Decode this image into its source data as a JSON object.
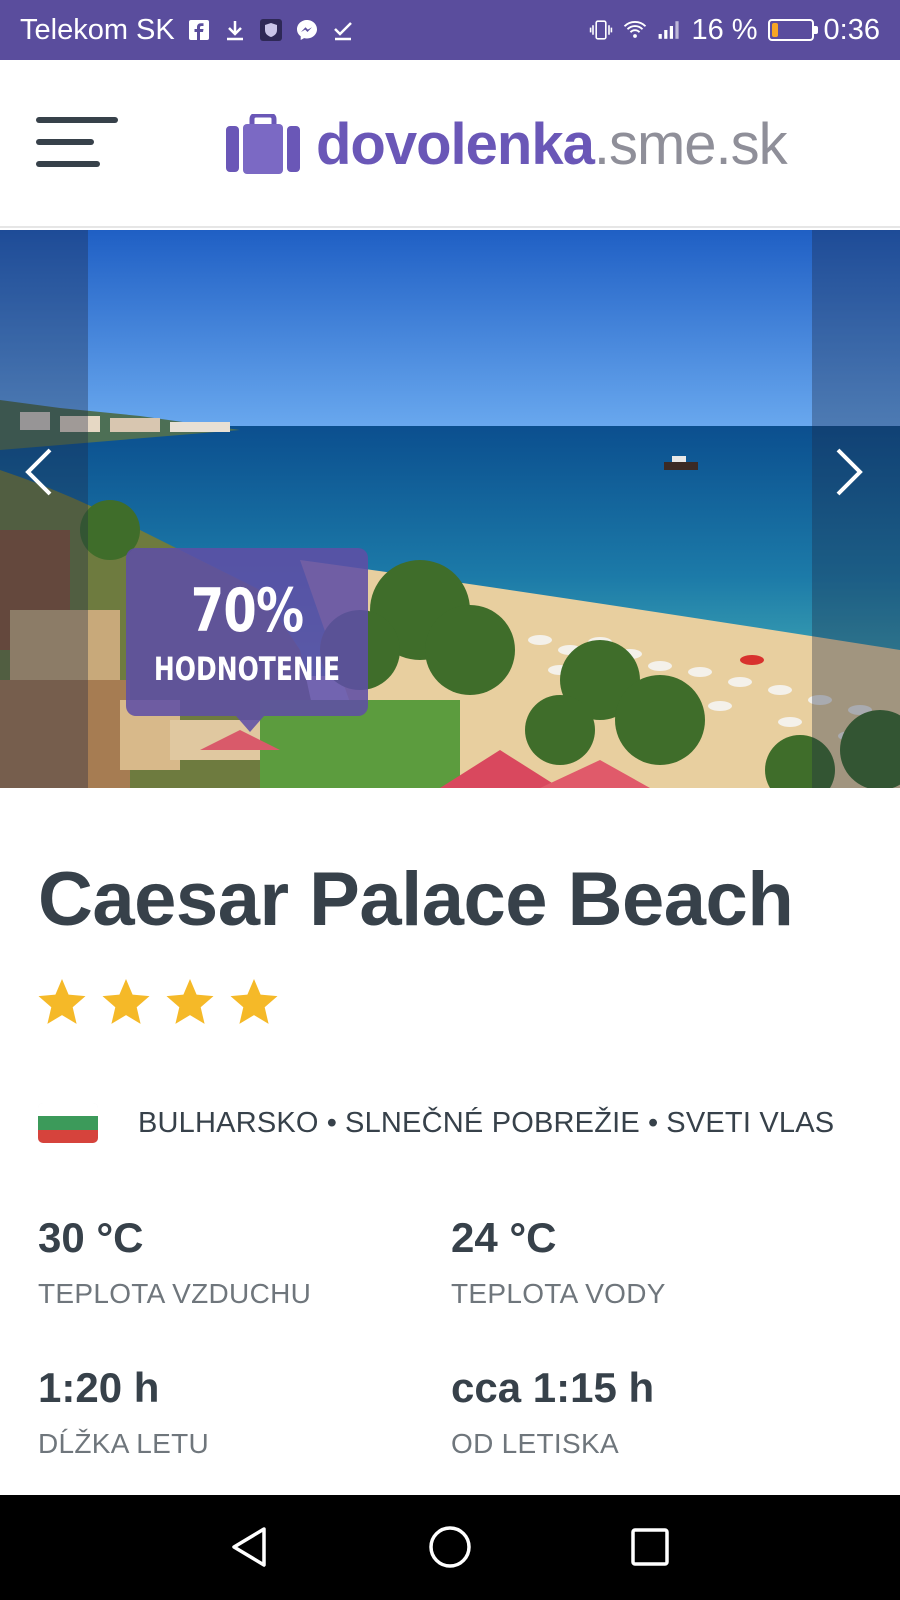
{
  "status_bar": {
    "carrier": "Telekom SK",
    "battery_text": "16 %",
    "time": "0:36",
    "battery_level": 0.16,
    "icons": [
      "facebook-icon",
      "download-icon",
      "shield-icon",
      "messenger-icon",
      "checkmark-icon",
      "vibrate-icon",
      "wifi-icon",
      "signal-icon",
      "battery-icon"
    ]
  },
  "header": {
    "logo_main": "dovolenka",
    "logo_suffix": ".sme.sk",
    "brand_color": "#6a57b7"
  },
  "hero": {
    "rating_value": "70%",
    "rating_label": "HODNOTENIE",
    "rating_color": "#5f4ea5"
  },
  "hotel": {
    "name": "Caesar Palace Beach",
    "stars": 4,
    "star_color": "#f5b928",
    "location": {
      "country": "BULHARSKO",
      "region": "SLNEČNÉ POBREŽIE",
      "city": "SVETI VLAS",
      "separator": "•"
    }
  },
  "stats": [
    {
      "value": "30 °C",
      "label": "TEPLOTA VZDUCHU"
    },
    {
      "value": "24 °C",
      "label": "TEPLOTA VODY"
    },
    {
      "value": "1:20 h",
      "label": "DĹŽKA LETU"
    },
    {
      "value": "cca 1:15 h",
      "label": "OD LETISKA"
    }
  ]
}
